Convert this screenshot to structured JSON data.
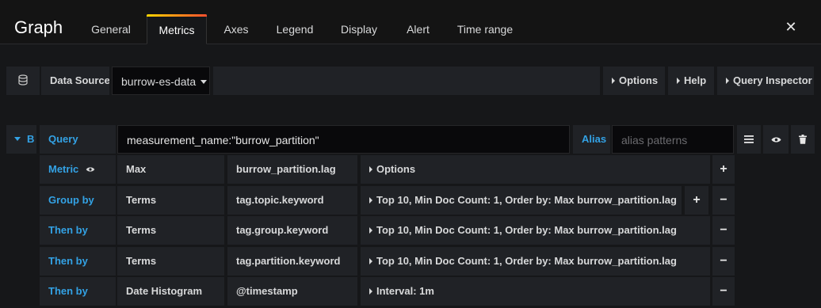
{
  "header": {
    "title": "Graph",
    "tabs": [
      "General",
      "Metrics",
      "Axes",
      "Legend",
      "Display",
      "Alert",
      "Time range"
    ],
    "active_tab": "Metrics",
    "close_icon": "close-icon"
  },
  "datasource": {
    "icon": "database-icon",
    "label": "Data Source",
    "selected": "burrow-es-data",
    "options_label": "Options",
    "help_label": "Help",
    "inspector_label": "Query Inspector"
  },
  "query": {
    "ref_id": "B",
    "query_label": "Query",
    "query_value": "measurement_name:\"burrow_partition\"",
    "alias_label": "Alias",
    "alias_placeholder": "alias patterns",
    "menu_icon": "hamburger-icon",
    "eye_icon": "eye-icon",
    "trash_icon": "trash-icon"
  },
  "metric": {
    "label": "Metric",
    "type": "Max",
    "field": "burrow_partition.lag",
    "options": "Options",
    "add_symbol": "+"
  },
  "buckets": [
    {
      "label": "Group by",
      "type": "Terms",
      "field": "tag.topic.keyword",
      "settings": "Top 10, Min Doc Count: 1, Order by: Max burrow_partition.lag",
      "add_symbol": "+",
      "remove_symbol": "−"
    },
    {
      "label": "Then by",
      "type": "Terms",
      "field": "tag.group.keyword",
      "settings": "Top 10, Min Doc Count: 1, Order by: Max burrow_partition.lag",
      "remove_symbol": "−"
    },
    {
      "label": "Then by",
      "type": "Terms",
      "field": "tag.partition.keyword",
      "settings": "Top 10, Min Doc Count: 1, Order by: Max burrow_partition.lag",
      "remove_symbol": "−"
    },
    {
      "label": "Then by",
      "type": "Date Histogram",
      "field": "@timestamp",
      "settings": "Interval: 1m",
      "remove_symbol": "−"
    }
  ]
}
